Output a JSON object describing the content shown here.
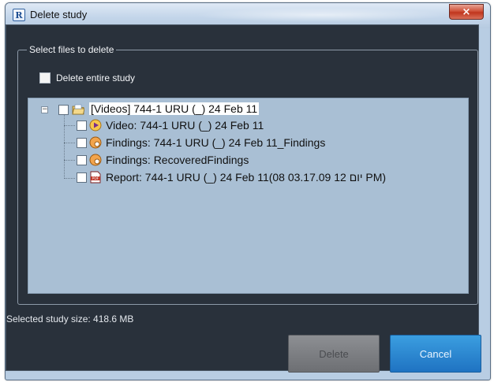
{
  "window": {
    "title": "Delete study",
    "app_icon_letter": "R",
    "close_glyph": "×"
  },
  "group": {
    "legend": "Select files to delete",
    "delete_entire_label": "Delete entire study",
    "delete_entire_checked": false
  },
  "tree": {
    "root": {
      "label": "[Videos] 744-1 URU (_) 24 Feb 11",
      "icon": "folder-icon",
      "expanded": true,
      "checked": false
    },
    "children": [
      {
        "label": "Video: 744-1 URU (_) 24 Feb 11",
        "icon": "play-icon",
        "checked": false
      },
      {
        "label": "Findings: 744-1 URU (_) 24 Feb 11_Findings",
        "icon": "findings-icon",
        "checked": false
      },
      {
        "label": "Findings: RecoveredFindings",
        "icon": "findings-icon",
        "checked": false
      },
      {
        "label": "Report: 744-1 URU (_) 24 Feb 11(08 03.17.09 12 יום PM)",
        "icon": "pdf-icon",
        "checked": false
      }
    ]
  },
  "status": {
    "size_text": "Selected study size: 418.6 MB"
  },
  "buttons": {
    "delete_label": "Delete",
    "cancel_label": "Cancel"
  },
  "colors": {
    "client_bg": "#29313b",
    "tree_bg": "#a9bfd4",
    "cancel_accent": "#1f73c2",
    "delete_disabled": "#6d6f73"
  }
}
